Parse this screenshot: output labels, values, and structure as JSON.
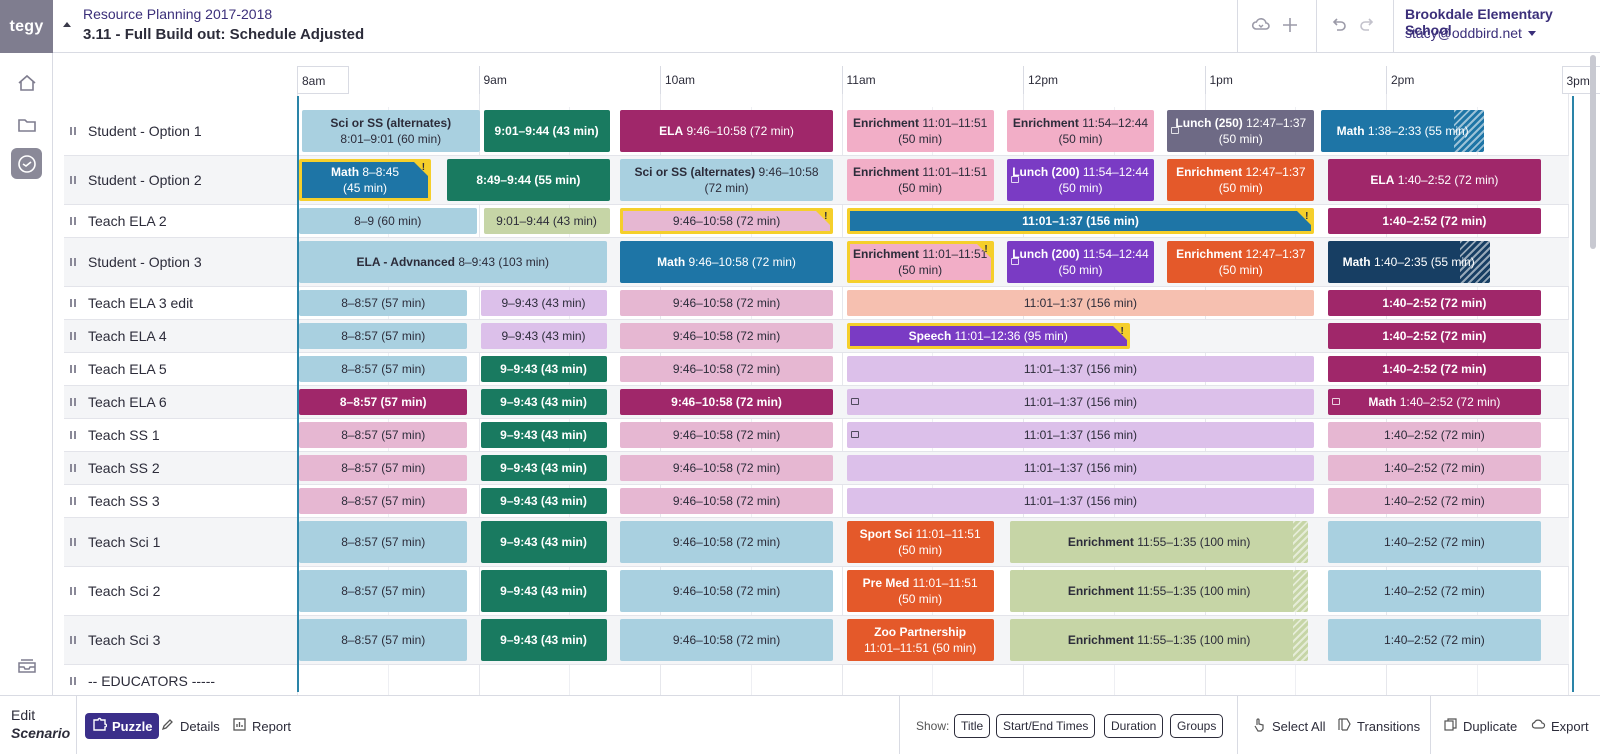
{
  "header": {
    "logo": "tegy",
    "project": "Resource Planning 2017-2018",
    "scenario": "3.11 - Full Build out: Schedule Adjusted",
    "school": "Brookdale Elementary School",
    "user": "stacy@oddbird.net",
    "icons": [
      "cloud-sync-icon",
      "plus-icon",
      "undo-icon",
      "redo-icon"
    ]
  },
  "sidebar": {
    "icons": [
      "home-icon",
      "folder-icon",
      "clock-icon",
      "inbox-icon"
    ],
    "active": "clock-icon"
  },
  "timeline": {
    "ticks": [
      "8am",
      "9am",
      "10am",
      "11am",
      "12pm",
      "1pm",
      "2pm",
      "3pm"
    ]
  },
  "rows": [
    {
      "name": "Student - Option 1",
      "blocks": [
        {
          "t1": "Sci or SS (alternates)",
          "t2": "8:01–9:01 (60 min)",
          "color": "#a9d0e0",
          "dark": false,
          "start": 481,
          "end": 541
        },
        {
          "t1": "",
          "t2": "9:01–9:44 (43 min)",
          "color": "#197a60",
          "dark": true,
          "start": 541,
          "end": 584,
          "single": true
        },
        {
          "t1": "ELA",
          "t2": "9:46–10:58 (72 min)",
          "color": "#a0276a",
          "dark": true,
          "start": 586,
          "end": 658,
          "single": true
        },
        {
          "t1": "Enrichment",
          "t2": "11:01–11:51",
          "t3": "(50 min)",
          "color": "#f2aec7",
          "dark": false,
          "start": 661,
          "end": 711,
          "wrap": true
        },
        {
          "t1": "Enrichment",
          "t2": "11:54–12:44",
          "t3": "(50 min)",
          "color": "#f2aec7",
          "dark": false,
          "start": 714,
          "end": 764,
          "wrap": true
        },
        {
          "t1": "Lunch (250)",
          "t2": "12:47–1:37",
          "t3": "(50 min)",
          "color": "#6e6a85",
          "dark": true,
          "start": 767,
          "end": 817,
          "wrap": true,
          "icon": true
        },
        {
          "t1": "Math",
          "t2": "1:38–2:33 (55 min)",
          "color": "#1e75a6",
          "dark": true,
          "start": 818,
          "end": 873,
          "single": true,
          "hatch": 10
        }
      ]
    },
    {
      "name": "Student - Option 2",
      "blocks": [
        {
          "t1": "Math",
          "t2": "8–8:45",
          "t3": "(45 min)",
          "color": "#1e75a6",
          "dark": true,
          "start": 480,
          "end": 525,
          "wrap": true,
          "flag": true
        },
        {
          "t1": "",
          "t2": "8:49–9:44 (55 min)",
          "color": "#197a60",
          "dark": true,
          "start": 529,
          "end": 584,
          "single": true
        },
        {
          "t1": "Sci or SS (alternates)",
          "t2": "9:46–10:58",
          "t3": "(72 min)",
          "color": "#a9d0e0",
          "dark": false,
          "start": 586,
          "end": 658,
          "wrap": true
        },
        {
          "t1": "Enrichment",
          "t2": "11:01–11:51",
          "t3": "(50 min)",
          "color": "#f2aec7",
          "dark": false,
          "start": 661,
          "end": 711,
          "wrap": true
        },
        {
          "t1": "Lunch (200)",
          "t2": "11:54–12:44",
          "t3": "(50 min)",
          "color": "#7a3bc4",
          "dark": true,
          "start": 714,
          "end": 764,
          "wrap": true,
          "icon": true
        },
        {
          "t1": "Enrichment",
          "t2": "12:47–1:37",
          "t3": "(50 min)",
          "color": "#e4592a",
          "dark": true,
          "start": 767,
          "end": 817,
          "wrap": true
        },
        {
          "t1": "ELA",
          "t2": "1:40–2:52 (72 min)",
          "color": "#a0276a",
          "dark": true,
          "start": 820,
          "end": 892,
          "single": true
        }
      ]
    },
    {
      "name": "Teach ELA 2",
      "blocks": [
        {
          "t1": "",
          "t2": "8–9 (60 min)",
          "color": "#a9d0e0",
          "dark": false,
          "start": 480,
          "end": 540,
          "single": true
        },
        {
          "t1": "",
          "t2": "9:01–9:44 (43 min)",
          "color": "#c6d5a6",
          "dark": false,
          "start": 541,
          "end": 584,
          "single": true
        },
        {
          "t1": "",
          "t2": "9:46–10:58 (72 min)",
          "color": "#e6b7d2",
          "dark": false,
          "start": 586,
          "end": 658,
          "single": true,
          "flag": true
        },
        {
          "t1": "",
          "t2": "11:01–1:37 (156 min)",
          "color": "#1e75a6",
          "dark": true,
          "start": 661,
          "end": 817,
          "single": true,
          "flag": true
        },
        {
          "t1": "",
          "t2": "1:40–2:52 (72 min)",
          "color": "#a0276a",
          "dark": true,
          "start": 820,
          "end": 892,
          "single": true
        }
      ]
    },
    {
      "name": "Student - Option 3",
      "blocks": [
        {
          "t1": "ELA - Advnanced",
          "t2": "8–9:43 (103 min)",
          "color": "#a9d0e0",
          "dark": false,
          "start": 480,
          "end": 583,
          "single": true
        },
        {
          "t1": "Math",
          "t2": "9:46–10:58 (72 min)",
          "color": "#1e75a6",
          "dark": true,
          "start": 586,
          "end": 658,
          "single": true
        },
        {
          "t1": "Enrichment",
          "t2": "11:01–11:51",
          "t3": "(50 min)",
          "color": "#f2aec7",
          "dark": false,
          "start": 661,
          "end": 711,
          "wrap": true,
          "flag": true
        },
        {
          "t1": "Lunch (200)",
          "t2": "11:54–12:44",
          "t3": "(50 min)",
          "color": "#7a3bc4",
          "dark": true,
          "start": 714,
          "end": 764,
          "wrap": true,
          "icon": true
        },
        {
          "t1": "Enrichment",
          "t2": "12:47–1:37",
          "t3": "(50 min)",
          "color": "#e4592a",
          "dark": true,
          "start": 767,
          "end": 817,
          "wrap": true
        },
        {
          "t1": "Math",
          "t2": "1:40–2:35 (55 min)",
          "color": "#173e63",
          "dark": true,
          "start": 820,
          "end": 875,
          "single": true,
          "hatch": 10
        }
      ]
    },
    {
      "name": "Teach ELA 3 edit",
      "blocks": [
        {
          "t1": "",
          "t2": "8–8:57 (57 min)",
          "color": "#a9d0e0",
          "dark": false,
          "start": 480,
          "end": 537,
          "single": true
        },
        {
          "t1": "",
          "t2": "9–9:43 (43 min)",
          "color": "#dcc0ea",
          "dark": false,
          "start": 540,
          "end": 583,
          "single": true
        },
        {
          "t1": "",
          "t2": "9:46–10:58 (72 min)",
          "color": "#e6b7d2",
          "dark": false,
          "start": 586,
          "end": 658,
          "single": true
        },
        {
          "t1": "",
          "t2": "11:01–1:37 (156 min)",
          "color": "#f6c0b0",
          "dark": false,
          "start": 661,
          "end": 817,
          "single": true
        },
        {
          "t1": "",
          "t2": "1:40–2:52 (72 min)",
          "color": "#a0276a",
          "dark": true,
          "start": 820,
          "end": 892,
          "single": true
        }
      ]
    },
    {
      "name": "Teach ELA 4",
      "blocks": [
        {
          "t1": "",
          "t2": "8–8:57 (57 min)",
          "color": "#a9d0e0",
          "dark": false,
          "start": 480,
          "end": 537,
          "single": true
        },
        {
          "t1": "",
          "t2": "9–9:43 (43 min)",
          "color": "#dcc0ea",
          "dark": false,
          "start": 540,
          "end": 583,
          "single": true
        },
        {
          "t1": "",
          "t2": "9:46–10:58 (72 min)",
          "color": "#e6b7d2",
          "dark": false,
          "start": 586,
          "end": 658,
          "single": true
        },
        {
          "t1": "Speech",
          "t2": "11:01–12:36 (95 min)",
          "color": "#7a3bc4",
          "dark": true,
          "start": 661,
          "end": 756,
          "single": true,
          "flag": true
        },
        {
          "t1": "",
          "t2": "1:40–2:52 (72 min)",
          "color": "#a0276a",
          "dark": true,
          "start": 820,
          "end": 892,
          "single": true
        }
      ]
    },
    {
      "name": "Teach ELA 5",
      "blocks": [
        {
          "t1": "",
          "t2": "8–8:57 (57 min)",
          "color": "#a9d0e0",
          "dark": false,
          "start": 480,
          "end": 537,
          "single": true
        },
        {
          "t1": "",
          "t2": "9–9:43 (43 min)",
          "color": "#197a60",
          "dark": true,
          "start": 540,
          "end": 583,
          "single": true
        },
        {
          "t1": "",
          "t2": "9:46–10:58 (72 min)",
          "color": "#e6b7d2",
          "dark": false,
          "start": 586,
          "end": 658,
          "single": true
        },
        {
          "t1": "",
          "t2": "11:01–1:37 (156 min)",
          "color": "#dcc0ea",
          "dark": false,
          "start": 661,
          "end": 817,
          "single": true
        },
        {
          "t1": "",
          "t2": "1:40–2:52 (72 min)",
          "color": "#a0276a",
          "dark": true,
          "start": 820,
          "end": 892,
          "single": true
        }
      ]
    },
    {
      "name": "Teach ELA 6",
      "blocks": [
        {
          "t1": "",
          "t2": "8–8:57 (57 min)",
          "color": "#a0276a",
          "dark": true,
          "start": 480,
          "end": 537,
          "single": true
        },
        {
          "t1": "",
          "t2": "9–9:43 (43 min)",
          "color": "#197a60",
          "dark": true,
          "start": 540,
          "end": 583,
          "single": true
        },
        {
          "t1": "",
          "t2": "9:46–10:58 (72 min)",
          "color": "#a0276a",
          "dark": true,
          "start": 586,
          "end": 658,
          "single": true
        },
        {
          "t1": "",
          "t2": "11:01–1:37 (156 min)",
          "color": "#dcc0ea",
          "dark": false,
          "start": 661,
          "end": 817,
          "single": true,
          "icon": true
        },
        {
          "t1": "Math",
          "t2": "1:40–2:52 (72 min)",
          "color": "#a0276a",
          "dark": true,
          "start": 820,
          "end": 892,
          "single": true,
          "icon": true
        }
      ]
    },
    {
      "name": "Teach SS 1",
      "blocks": [
        {
          "t1": "",
          "t2": "8–8:57 (57 min)",
          "color": "#e6b7d2",
          "dark": false,
          "start": 480,
          "end": 537,
          "single": true
        },
        {
          "t1": "",
          "t2": "9–9:43 (43 min)",
          "color": "#197a60",
          "dark": true,
          "start": 540,
          "end": 583,
          "single": true
        },
        {
          "t1": "",
          "t2": "9:46–10:58 (72 min)",
          "color": "#e6b7d2",
          "dark": false,
          "start": 586,
          "end": 658,
          "single": true
        },
        {
          "t1": "",
          "t2": "11:01–1:37 (156 min)",
          "color": "#dcc0ea",
          "dark": false,
          "start": 661,
          "end": 817,
          "single": true,
          "icon": true
        },
        {
          "t1": "",
          "t2": "1:40–2:52 (72 min)",
          "color": "#e6b7d2",
          "dark": false,
          "start": 820,
          "end": 892,
          "single": true
        }
      ]
    },
    {
      "name": "Teach SS 2",
      "blocks": [
        {
          "t1": "",
          "t2": "8–8:57 (57 min)",
          "color": "#e6b7d2",
          "dark": false,
          "start": 480,
          "end": 537,
          "single": true
        },
        {
          "t1": "",
          "t2": "9–9:43 (43 min)",
          "color": "#197a60",
          "dark": true,
          "start": 540,
          "end": 583,
          "single": true
        },
        {
          "t1": "",
          "t2": "9:46–10:58 (72 min)",
          "color": "#e6b7d2",
          "dark": false,
          "start": 586,
          "end": 658,
          "single": true
        },
        {
          "t1": "",
          "t2": "11:01–1:37 (156 min)",
          "color": "#dcc0ea",
          "dark": false,
          "start": 661,
          "end": 817,
          "single": true
        },
        {
          "t1": "",
          "t2": "1:40–2:52 (72 min)",
          "color": "#e6b7d2",
          "dark": false,
          "start": 820,
          "end": 892,
          "single": true
        }
      ]
    },
    {
      "name": "Teach SS 3",
      "blocks": [
        {
          "t1": "",
          "t2": "8–8:57 (57 min)",
          "color": "#e6b7d2",
          "dark": false,
          "start": 480,
          "end": 537,
          "single": true
        },
        {
          "t1": "",
          "t2": "9–9:43 (43 min)",
          "color": "#197a60",
          "dark": true,
          "start": 540,
          "end": 583,
          "single": true
        },
        {
          "t1": "",
          "t2": "9:46–10:58 (72 min)",
          "color": "#e6b7d2",
          "dark": false,
          "start": 586,
          "end": 658,
          "single": true
        },
        {
          "t1": "",
          "t2": "11:01–1:37 (156 min)",
          "color": "#dcc0ea",
          "dark": false,
          "start": 661,
          "end": 817,
          "single": true
        },
        {
          "t1": "",
          "t2": "1:40–2:52 (72 min)",
          "color": "#e6b7d2",
          "dark": false,
          "start": 820,
          "end": 892,
          "single": true
        }
      ]
    },
    {
      "name": "Teach Sci 1",
      "blocks": [
        {
          "t1": "",
          "t2": "8–8:57 (57 min)",
          "color": "#a9d0e0",
          "dark": false,
          "start": 480,
          "end": 537,
          "single": true
        },
        {
          "t1": "",
          "t2": "9–9:43 (43 min)",
          "color": "#197a60",
          "dark": true,
          "start": 540,
          "end": 583,
          "single": true
        },
        {
          "t1": "",
          "t2": "9:46–10:58 (72 min)",
          "color": "#a9d0e0",
          "dark": false,
          "start": 586,
          "end": 658,
          "single": true
        },
        {
          "t1": "Sport Sci",
          "t2": "11:01–11:51",
          "t3": "(50 min)",
          "color": "#e4592a",
          "dark": true,
          "start": 661,
          "end": 711,
          "wrap": true
        },
        {
          "t1": "Enrichment",
          "t2": "11:55–1:35 (100 min)",
          "color": "#c6d5a6",
          "dark": false,
          "start": 715,
          "end": 815,
          "single": true,
          "hatch": 5
        },
        {
          "t1": "",
          "t2": "1:40–2:52 (72 min)",
          "color": "#a9d0e0",
          "dark": false,
          "start": 820,
          "end": 892,
          "single": true
        }
      ]
    },
    {
      "name": "Teach Sci 2",
      "blocks": [
        {
          "t1": "",
          "t2": "8–8:57 (57 min)",
          "color": "#a9d0e0",
          "dark": false,
          "start": 480,
          "end": 537,
          "single": true
        },
        {
          "t1": "",
          "t2": "9–9:43 (43 min)",
          "color": "#197a60",
          "dark": true,
          "start": 540,
          "end": 583,
          "single": true
        },
        {
          "t1": "",
          "t2": "9:46–10:58 (72 min)",
          "color": "#a9d0e0",
          "dark": false,
          "start": 586,
          "end": 658,
          "single": true
        },
        {
          "t1": "Pre Med",
          "t2": "11:01–11:51",
          "t3": "(50 min)",
          "color": "#e4592a",
          "dark": true,
          "start": 661,
          "end": 711,
          "wrap": true
        },
        {
          "t1": "Enrichment",
          "t2": "11:55–1:35 (100 min)",
          "color": "#c6d5a6",
          "dark": false,
          "start": 715,
          "end": 815,
          "single": true,
          "hatch": 5
        },
        {
          "t1": "",
          "t2": "1:40–2:52 (72 min)",
          "color": "#a9d0e0",
          "dark": false,
          "start": 820,
          "end": 892,
          "single": true
        }
      ]
    },
    {
      "name": "Teach Sci 3",
      "blocks": [
        {
          "t1": "",
          "t2": "8–8:57 (57 min)",
          "color": "#a9d0e0",
          "dark": false,
          "start": 480,
          "end": 537,
          "single": true
        },
        {
          "t1": "",
          "t2": "9–9:43 (43 min)",
          "color": "#197a60",
          "dark": true,
          "start": 540,
          "end": 583,
          "single": true
        },
        {
          "t1": "",
          "t2": "9:46–10:58 (72 min)",
          "color": "#a9d0e0",
          "dark": false,
          "start": 586,
          "end": 658,
          "single": true
        },
        {
          "t1": "Zoo Partnership",
          "t2": "11:01–11:51 (50 min)",
          "color": "#e4592a",
          "dark": true,
          "start": 661,
          "end": 711,
          "stack": true
        },
        {
          "t1": "Enrichment",
          "t2": "11:55–1:35 (100 min)",
          "color": "#c6d5a6",
          "dark": false,
          "start": 715,
          "end": 815,
          "single": true,
          "hatch": 5
        },
        {
          "t1": "",
          "t2": "1:40–2:52 (72 min)",
          "color": "#a9d0e0",
          "dark": false,
          "start": 820,
          "end": 892,
          "single": true
        }
      ]
    },
    {
      "name": "-- EDUCATORS -----",
      "blocks": []
    }
  ],
  "footer": {
    "mode_label": "Edit",
    "mode_value": "Scenario",
    "tabs": [
      {
        "label": "Puzzle",
        "active": true
      },
      {
        "label": "Details",
        "active": false
      },
      {
        "label": "Report",
        "active": false
      }
    ],
    "show_label": "Show:",
    "show_options": [
      "Title",
      "Start/End Times",
      "Duration",
      "Groups"
    ],
    "actions": [
      "Select All",
      "Transitions",
      "Duplicate",
      "Export"
    ]
  }
}
